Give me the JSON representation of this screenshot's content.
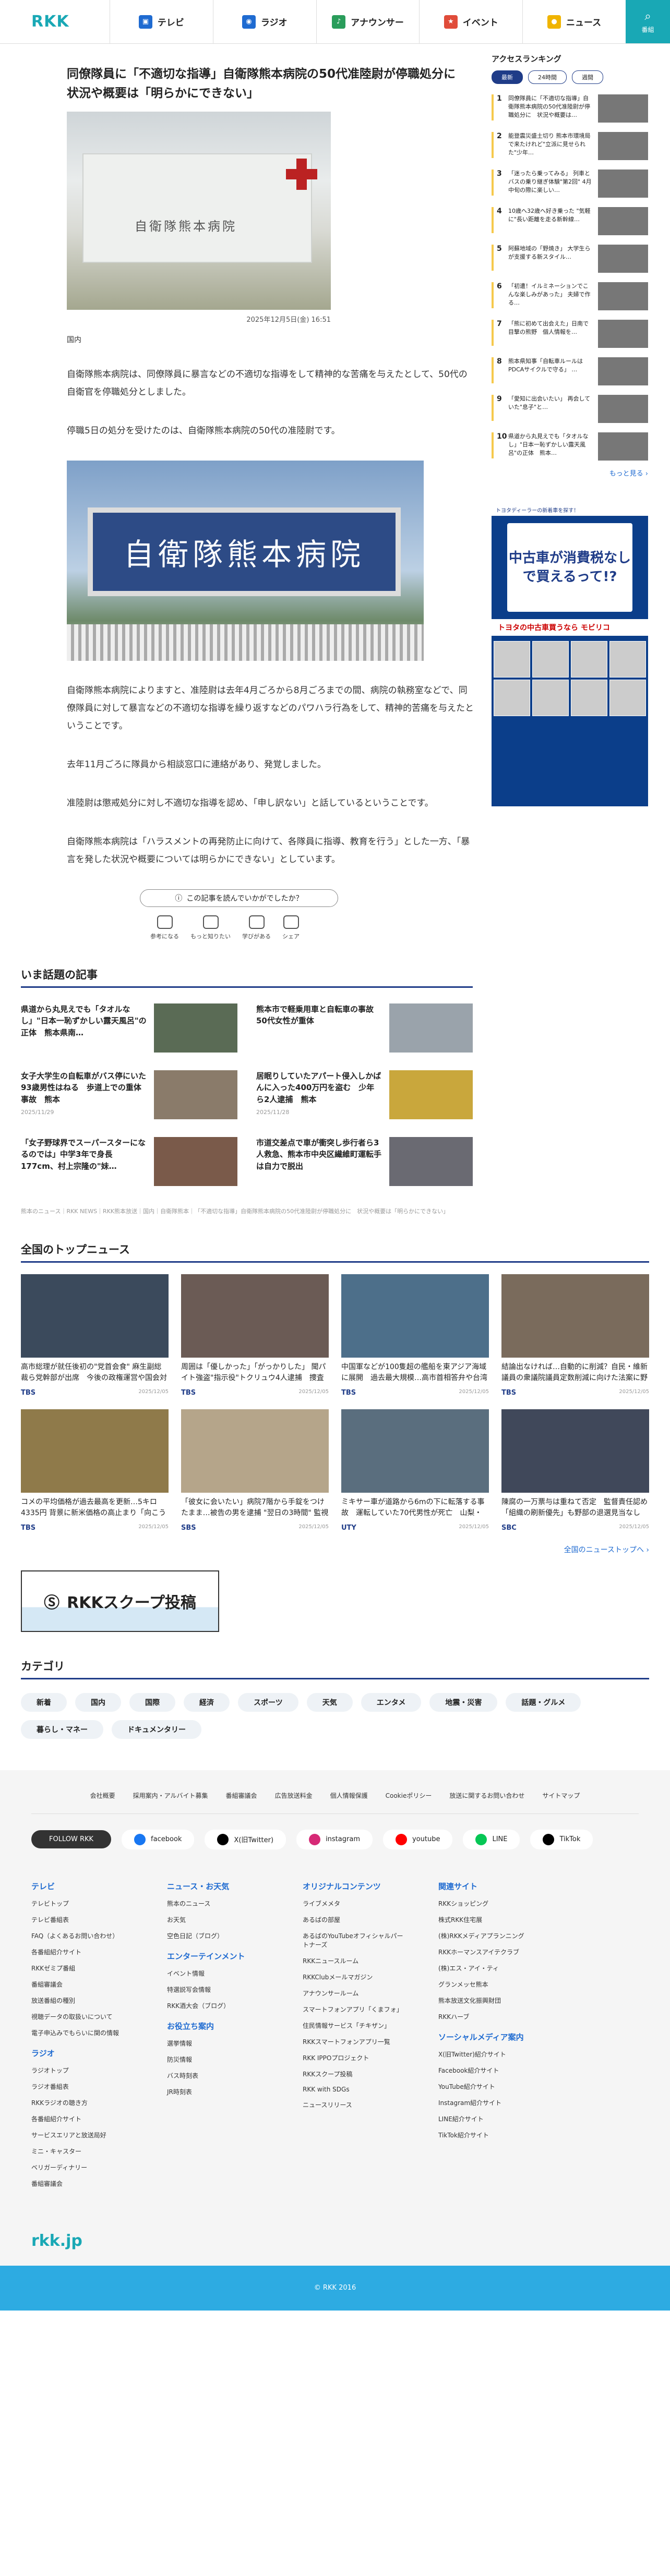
{
  "header": {
    "logo": "RKK",
    "nav": [
      {
        "label": "テレビ",
        "icon": "tv-icon",
        "color": "#1f6bd1"
      },
      {
        "label": "ラジオ",
        "icon": "radio-icon",
        "color": "#1f6bd1"
      },
      {
        "label": "アナウンサー",
        "icon": "announcer-icon",
        "color": "#2a9d5b"
      },
      {
        "label": "イベント",
        "icon": "event-icon",
        "color": "#e04c3a"
      },
      {
        "label": "ニュース",
        "icon": "news-icon",
        "color": "#f0b400"
      }
    ],
    "search_label": "番組"
  },
  "article": {
    "title": "同僚隊員に「不適切な指導」自衛隊熊本病院の50代准陸尉が停職処分に　状況や概要は「明らかにできない」",
    "date": "2025年12月5日(金) 16:51",
    "category": "国内",
    "paragraphs": [
      "自衛隊熊本病院は、同僚隊員に暴言などの不適切な指導をして精神的な苦痛を与えたとして、50代の自衛官を停職処分としました。",
      "停職5日の処分を受けたのは、自衛隊熊本病院の50代の准陸尉です。",
      "自衛隊熊本病院によりますと、准陸尉は去年4月ごろから8月ごろまでの間、病院の執務室などで、同僚隊員に対して暴言などの不適切な指導を繰り返すなどのパワハラ行為をして、精神的苦痛を与えたということです。",
      "去年11月ごろに隊員から相談窓口に連絡があり、発覚しました。",
      "准陸尉は懲戒処分に対し不適切な指導を認め、「申し訳ない」と話しているということです。",
      "自衛隊熊本病院は「ハラスメントの再発防止に向けて、各隊員に指導、教育を行う」とした一方、「暴言を発した状況や概要については明らかにできない」としています。"
    ],
    "photo2_sign": "自衛隊熊本病院",
    "photo1_sign": "自衛隊熊本病院"
  },
  "reaction": {
    "question": "この記事を読んでいかがでしたか？",
    "buttons": [
      "参考になる",
      "もっと知りたい",
      "学びがある",
      "シェア"
    ]
  },
  "hot": {
    "heading": "いま話題の記事",
    "items": [
      {
        "title": "県道から丸見えでも「タオルなし」\"日本一恥ずかしい露天風呂\"の正体　熊本県南…",
        "date": ""
      },
      {
        "title": "熊本市で軽乗用車と自転車の事故　50代女性が重体",
        "date": ""
      },
      {
        "title": "女子大学生の自転車がバス停にいた93歳男性はねる　歩道上での重体事故　熊本",
        "date": "2025/11/29"
      },
      {
        "title": "居眠りしていたアパート侵入しかばんに入った400万円を盗む　少年ら2人逮捕　熊本",
        "date": "2025/11/28"
      },
      {
        "title": "「女子野球界でスーパースターになるのでは」中学3年で身長177cm、村上宗隆の\"妹…",
        "date": ""
      },
      {
        "title": "市道交差点で車が衝突し歩行者ら3人救急、熊本市中央区繊維町運転手は自力で脱出",
        "date": ""
      }
    ],
    "credits": "熊本のニュース｜RKK NEWS｜RKK熊本放送｜国内｜自衛隊熊本｜「不適切な指導」自衛隊熊本病院の50代准陸尉が停職処分に　状況や概要は「明らかにできない」"
  },
  "top": {
    "heading": "全国のトップニュース",
    "items": [
      {
        "title": "高市総理が就任後初の\"党首会食\" 麻生副総裁ら党幹部が出席　今後の政権運営や国会対応など意見交換か",
        "src": "TBS",
        "date": "2025/12/05"
      },
      {
        "title": "周囲は「優しかった」「がっかりした」 聞パイト強盗\"指示役\"トクリュウ4人逮捕　捜査当局は「トクリュウ…",
        "src": "TBS",
        "date": "2025/12/05"
      },
      {
        "title": "中国軍などが100隻超の艦船を東アジア海域に展開　過去最大規模…高市首相答弁や台湾の発言背景か　中国は…",
        "src": "TBS",
        "date": "2025/12/05"
      },
      {
        "title": "結論出なければ…自動的に削減？自民・維新議員の衆議院議員定数削減に向けた法案に野党が反発「あまりに…",
        "src": "TBS",
        "date": "2025/12/05"
      },
      {
        "title": "コメの平均価格が過去最高を更新…5キロ4335円 背景に新米価格の高止まり「向こう3か月は安くなる見通し…",
        "src": "TBS",
        "date": "2025/12/05"
      },
      {
        "title": "「彼女に会いたい」病院7階から手錠をつけたまま…被告の男を逮捕 \"翌日の3時間\" 監視の隙に 病警察調べ…静岡…",
        "src": "SBS",
        "date": "2025/12/05"
      },
      {
        "title": "ミキサー車が道路から6mの下に転落する事故　運転していた70代男性が死亡　山梨・甲州市",
        "src": "UTY",
        "date": "2025/12/05"
      },
      {
        "title": "陳腐の一万票与は重ねて否定　監督責任認め「組織の刷新優先」も野部の退選見当なし　公取委の誤情提出を…",
        "src": "SBC",
        "date": "2025/12/05"
      }
    ],
    "more": "全国のニューストップへ ›"
  },
  "banner": "RKKスクープ投稿",
  "categories": {
    "heading": "カテゴリ",
    "items": [
      "新着",
      "国内",
      "国際",
      "経済",
      "スポーツ",
      "天気",
      "エンタメ",
      "地震・災害",
      "話題・グルメ",
      "暮らし・マネー",
      "ドキュメンタリー"
    ]
  },
  "ranking": {
    "heading": "アクセスランキング",
    "tabs": [
      "最新",
      "24時間",
      "週間"
    ],
    "items": [
      "同僚隊員に「不適切な指導」自衛隊熊本病院の50代准陸尉が停職処分に　状況や概要は…",
      "能登震災盛土切り 熊本市環境局で来たけれど\"立派に見せられた\"少年…",
      "「迷ったら乗ってみる」 列車とバスの乗り継ぎ体験\"第2回\" 4月中旬の際に楽しい…",
      "10歳へ32歳へ好き乗った \"気軽に\"長い距離を走る新幹線…",
      "阿蘇地域の「野焼き」 大学生らが支援する新スタイル…",
      "「初遭！イルミネーションでこんな楽しみがあった」 夫婦で作る…",
      "「熊に初めて出会えた」日南で目撃の熊野　個人情報を…",
      "熊本県知事「自転車ルールはPDCAサイクルで守る」 …",
      "「愛知に出会いたい」 再会していた\"息子\"と…",
      "県道から丸見えでも「タオルなし」\"日本一恥ずかしい露天風呂\"の正体　熊本…"
    ],
    "more": "もっと見る ›"
  },
  "ad": {
    "header": "トヨタディーラーの新着車を探す！",
    "headline": "中古車が消費税なしで買えるって!?",
    "line1": "トヨタの中古車買うなら",
    "brand": "モビリコ"
  },
  "footer": {
    "links": [
      "会社概要",
      "採用案内・アルバイト募集",
      "番組審議会",
      "広告放送料金",
      "個人情報保護",
      "Cookieポリシー",
      "放送に関するお問い合わせ",
      "サイトマップ"
    ],
    "follow": "FOLLOW RKK",
    "social": [
      {
        "label": "facebook",
        "color": "#1877f2"
      },
      {
        "label": "X(旧Twitter)",
        "color": "#000000"
      },
      {
        "label": "instagram",
        "color": "#d62976"
      },
      {
        "label": "youtube",
        "color": "#ff0000"
      },
      {
        "label": "LINE",
        "color": "#06c755"
      },
      {
        "label": "TikTok",
        "color": "#000000"
      }
    ],
    "cols": [
      {
        "head": "テレビ",
        "items": [
          "テレビトップ",
          "テレビ番組表",
          "FAQ（よくあるお問い合わせ）",
          "各番組紹介サイト",
          "RKKゼミプ番組",
          "番組審議会",
          "放送番組の種別",
          "視聴データの取扱いについて",
          "電子申込みでもらいに関の情報"
        ]
      },
      {
        "head": "ラジオ",
        "items": [
          "ラジオトップ",
          "ラジオ番組表",
          "RKKラジオの聴き方",
          "各番組紹介サイト",
          "サービスエリアと放送局好",
          "ミニ・キャスター",
          "ベリガーディナリー",
          "番組審議会"
        ]
      },
      {
        "head": "ニュース・お天気",
        "items": [
          "熊本のニュース",
          "お天気",
          "空色日記（ブログ）"
        ]
      },
      {
        "head": "エンターテインメント",
        "items": [
          "イベント情報",
          "特選説写会情報",
          "RKK酒大会（ブログ）"
        ]
      },
      {
        "head": "お役立ち案内",
        "items": [
          "選挙情報",
          "防災情報",
          "バス時刻表",
          "JR時刻表"
        ]
      },
      {
        "head": "オリジナルコンテンツ",
        "items": [
          "ライブメメタ"
        ]
      },
      {
        "head": "",
        "items": [
          "あるばの部屋",
          "あるばのYouTubeオフィシャルパートナーズ",
          "RKKニュースルーム",
          "RKKClubメールマガジン",
          "アナウンサールーム",
          "スマートフォンアプリ「くまフォ」",
          "住民情報サービス「チキザン」",
          "RKKスマートフォンアプリ一覧",
          "RKK IPPOプロジェクト",
          "RKKスクープ投稿",
          "RKK with SDGs",
          "ニュースリリース"
        ]
      },
      {
        "head": "関連サイト",
        "items": [
          "RKKショッピング",
          "株式RKK住宅展",
          "(株)RKKメディアプランニング",
          "RKKホーマンスアイテクラブ",
          "(株)エス・アイ・ティ",
          "グランメッセ熊本",
          "熊本放送文化振興財団",
          "RKKハーブ"
        ]
      },
      {
        "head": "ソーシャルメディア案内",
        "items": [
          "X(旧Twitter)紹介サイト",
          "Facebook紹介サイト",
          "YouTube紹介サイト",
          "Instagram紹介サイト",
          "LINE紹介サイト",
          "TikTok紹介サイト"
        ]
      }
    ],
    "logo": "rkk.jp",
    "copyright": "© RKK 2016"
  }
}
